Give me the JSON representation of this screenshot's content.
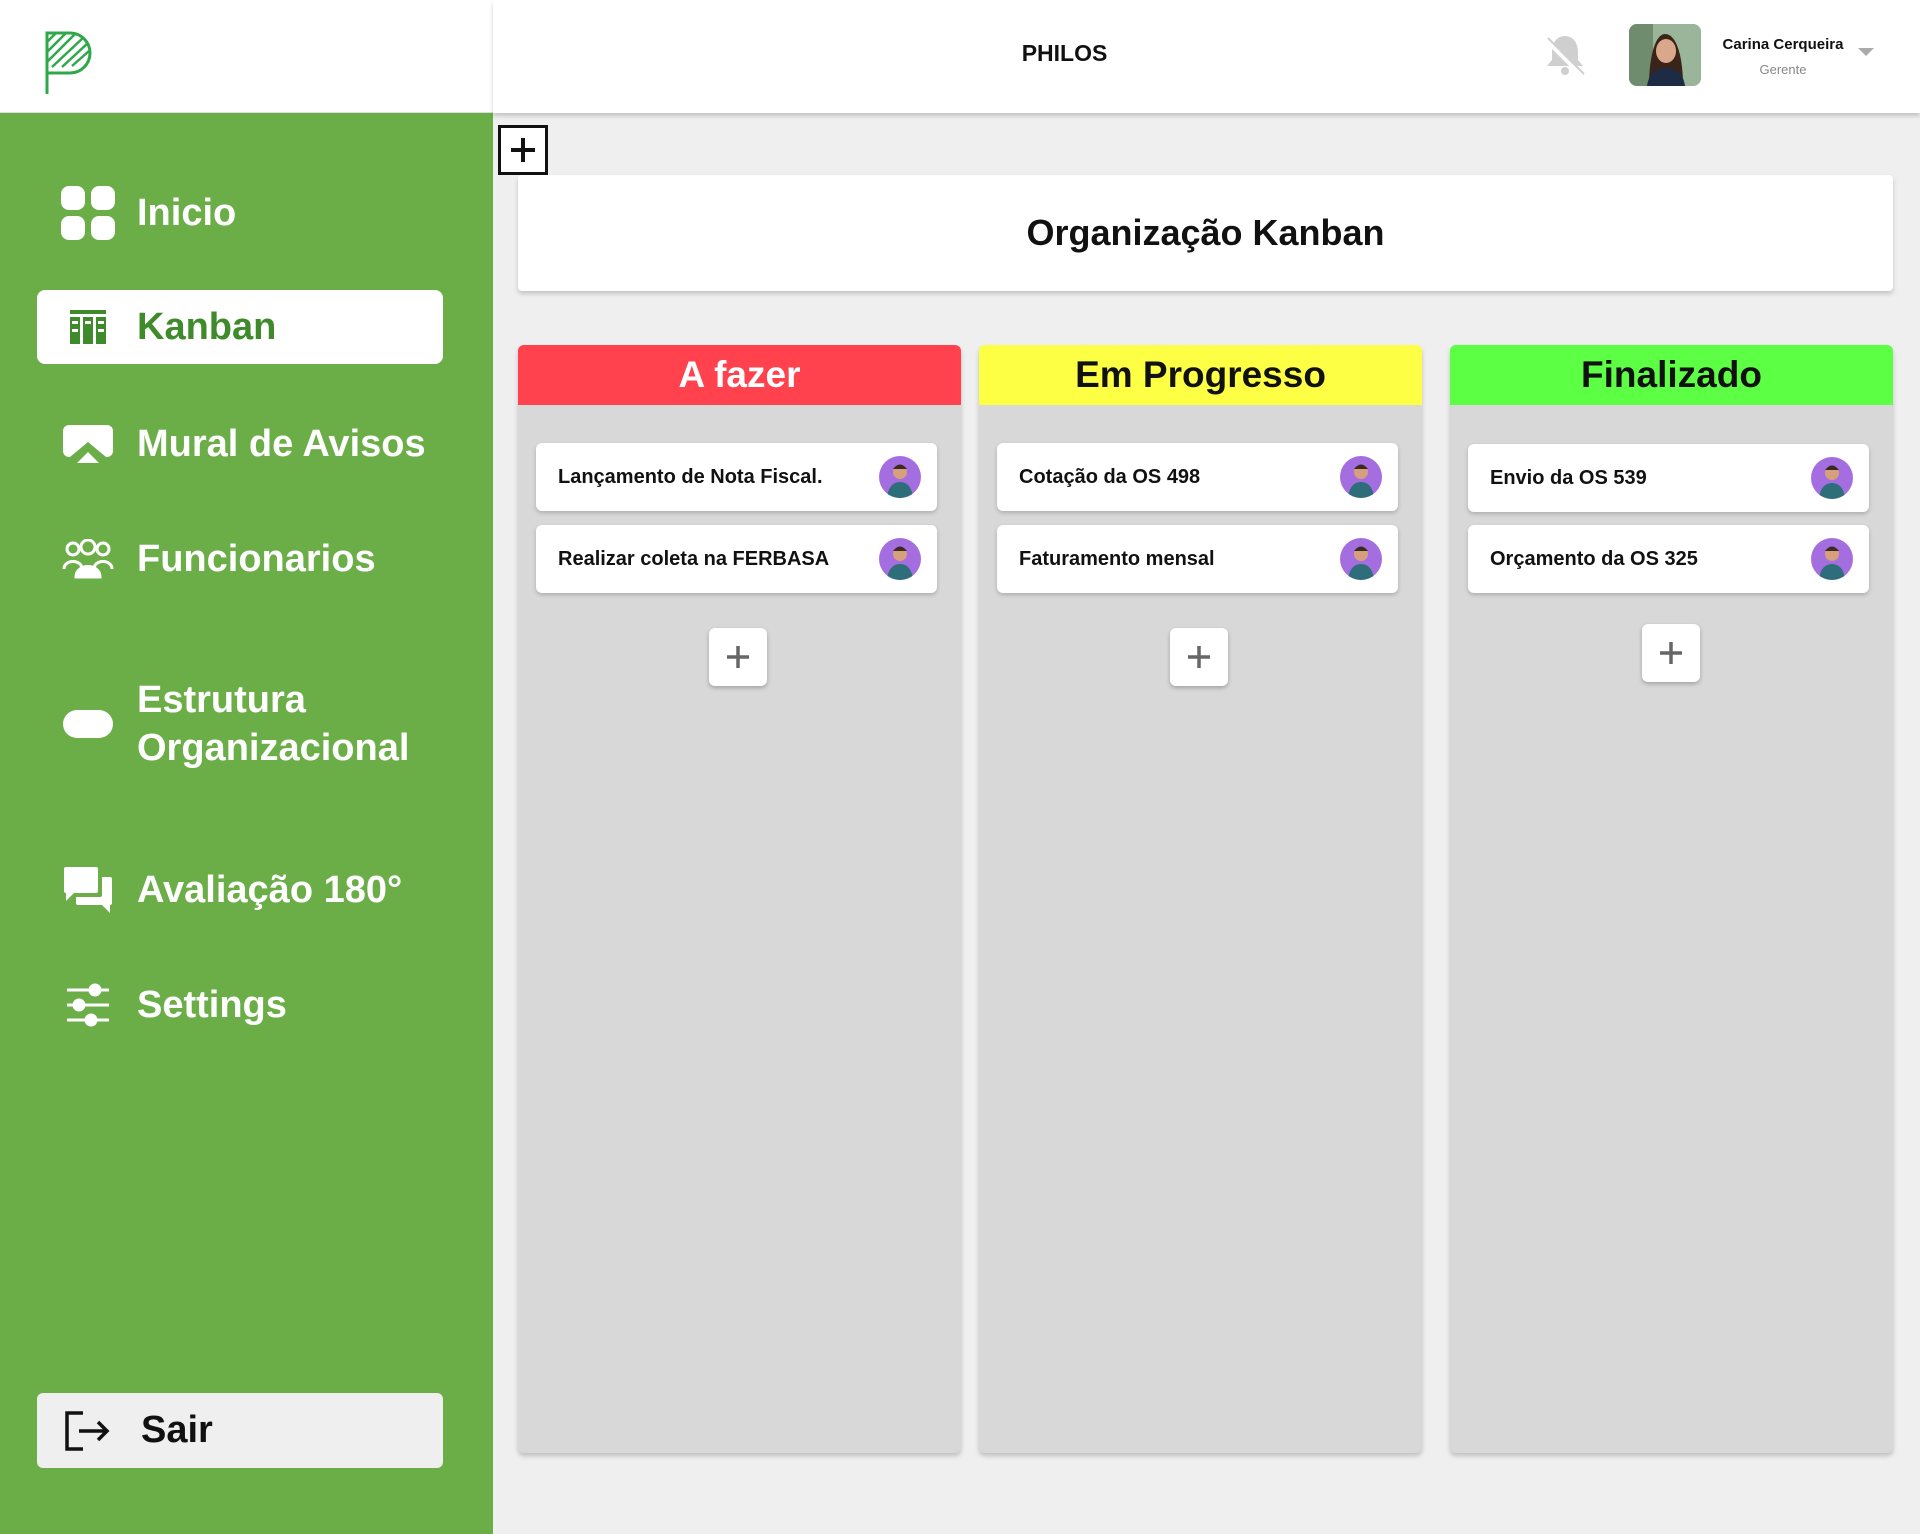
{
  "app": {
    "title": "PHILOS"
  },
  "user": {
    "name": "Carina Cerqueira",
    "role": "Gerente"
  },
  "sidebar": {
    "items": [
      {
        "label": "Inicio",
        "icon": "grid-icon"
      },
      {
        "label": "Kanban",
        "icon": "kanban-icon"
      },
      {
        "label": "Mural de Avisos",
        "icon": "image-icon"
      },
      {
        "label": "Funcionarios",
        "icon": "users-icon"
      },
      {
        "label": "Estrutura Organizacional",
        "icon": "pill-icon"
      },
      {
        "label": "Avaliação 180°",
        "icon": "chat-icon"
      },
      {
        "label": "Settings",
        "icon": "sliders-icon"
      }
    ],
    "logout_label": "Sair"
  },
  "page": {
    "header": "Organização Kanban"
  },
  "colors": {
    "sidebar": "#6bae48",
    "todo": "#ff424e",
    "progress": "#fcff44",
    "done": "#5dff44"
  },
  "columns": [
    {
      "title": "A fazer",
      "cards": [
        "Lançamento de Nota Fiscal.",
        "Realizar coleta na FERBASA"
      ]
    },
    {
      "title": "Em Progresso",
      "cards": [
        "Cotação da OS 498",
        "Faturamento mensal"
      ]
    },
    {
      "title": "Finalizado",
      "cards": [
        "Envio da OS 539",
        "Orçamento da OS 325"
      ]
    }
  ]
}
